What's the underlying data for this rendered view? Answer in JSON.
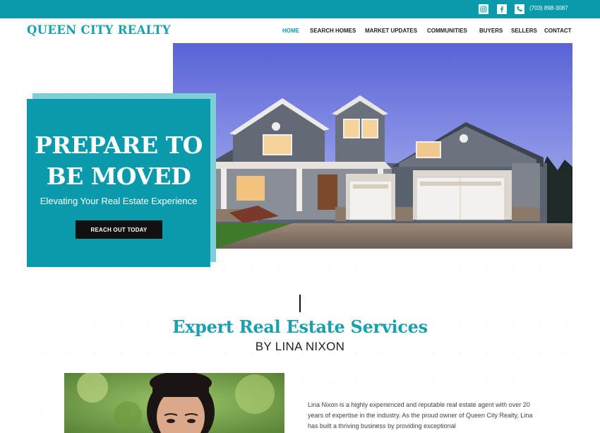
{
  "topbar": {
    "phone": "(703) 898-3087",
    "icons": [
      "instagram-icon",
      "facebook-icon",
      "phone-icon"
    ],
    "color": "#0b9aab"
  },
  "header": {
    "logo": "QUEEN CITY REALTY",
    "nav": [
      {
        "label": "HOME",
        "active": true
      },
      {
        "label": "SEARCH HOMES",
        "active": false
      },
      {
        "label": "MARKET UPDATES",
        "active": false
      },
      {
        "label": "COMMUNITIES",
        "active": false
      },
      {
        "label": "BUYERS",
        "active": false
      },
      {
        "label": "SELLERS",
        "active": false
      },
      {
        "label": "CONTACT",
        "active": false
      }
    ]
  },
  "hero": {
    "title": "PREPARE TO BE MOVED",
    "subtitle": "Elevating Your Real Estate Experience",
    "cta": "REACH OUT TODAY"
  },
  "services": {
    "title": "Expert Real Estate Services",
    "subtitle": "BY LINA NIXON",
    "bio": "Lina Nixon is a highly experienced and reputable real estate agent with over 20 years of expertise in the industry. As the proud owner of Queen City Realty, Lina has built a thriving business by providing exceptional"
  },
  "colors": {
    "accent": "#0b9aab",
    "logo": "#1a9fae",
    "button": "#111111"
  }
}
